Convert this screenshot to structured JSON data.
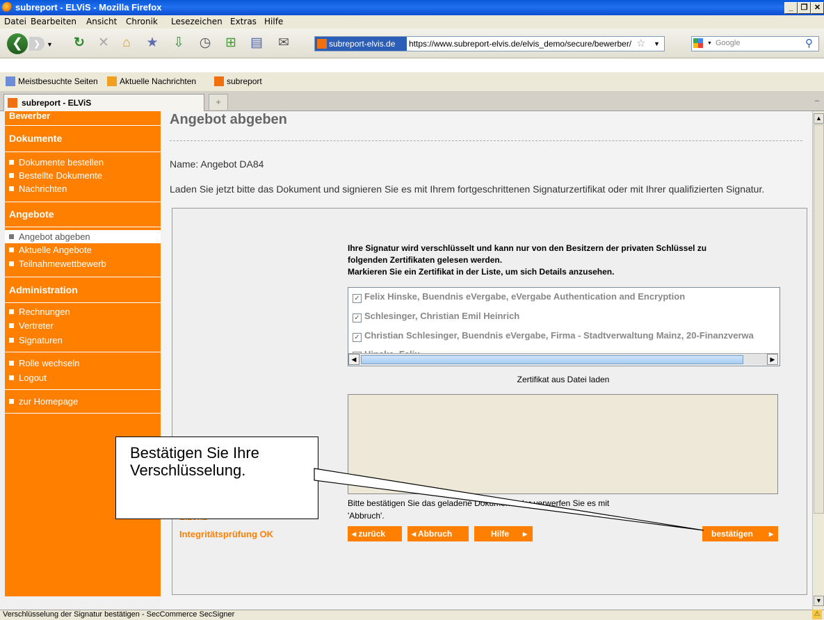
{
  "window": {
    "title": "subreport - ELViS - Mozilla Firefox"
  },
  "menu": [
    "Datei",
    "Bearbeiten",
    "Ansicht",
    "Chronik",
    "Lesezeichen",
    "Extras",
    "Hilfe"
  ],
  "address": {
    "site_label": "subreport-elvis.de",
    "url": "https://www.subreport-elvis.de/elvis_demo/secure/bewerber/",
    "search_placeholder": "Google"
  },
  "bookmarks": [
    "Meistbesuchte Seiten",
    "Aktuelle Nachrichten",
    "subreport"
  ],
  "tab": {
    "title": "subreport - ELViS",
    "new_tab": "+"
  },
  "sidebar": {
    "top_label": "Bewerber",
    "sections": [
      {
        "title": "Dokumente",
        "items": [
          "Dokumente bestellen",
          "Bestellte Dokumente",
          "Nachrichten"
        ]
      },
      {
        "title": "Angebote",
        "items": [
          "Angebot abgeben",
          "Aktuelle Angebote",
          "Teilnahmewettbewerb"
        ]
      },
      {
        "title": "Administration",
        "items": [
          "Rechnungen",
          "Vertreter",
          "Signaturen"
        ]
      }
    ],
    "extra_items": [
      "Rolle wechseln",
      "Logout"
    ],
    "home_item": "zur Homepage"
  },
  "main": {
    "heading": "Angebot abgeben",
    "name_line": "Name: Angebot DA84",
    "instruction": "Laden Sie jetzt bitte das Dokument und signieren Sie es mit Ihrem fortgeschrittenen Signaturzertifikat oder mit Ihrer qualifizierten Signatur."
  },
  "applet": {
    "info_line1": "Ihre Signatur wird verschlüsselt und kann nur von den Besitzern der privaten Schlüssel zu",
    "info_line2": "folgenden Zertifikaten gelesen werden.",
    "info_line3": "Markieren Sie ein Zertifikat in der Liste, um sich Details anzusehen.",
    "certificates": [
      "Felix Hinske, Buendnis eVergabe, eVergabe Authentication and Encryption",
      "Schlesinger, Christian Emil Heinrich",
      "Christian Schlesinger, Buendnis eVergabe, Firma - Stadtverwaltung Mainz, 20-Finanzverwa",
      "Hinske, Felix"
    ],
    "load_cert": "Zertifikat aus Datei laden",
    "confirm_text_1": "Bitte bestätigen Sie das geladene Dokument oder verwerfen Sie es mit",
    "confirm_text_2": "'Abbruch'.",
    "lizenz": "Lizenz",
    "integrity": "Integritätsprüfung OK",
    "buttons": {
      "back": "zurück",
      "cancel": "Abbruch",
      "help": "Hilfe",
      "confirm": "bestätigen"
    }
  },
  "callout": {
    "line1": "Bestätigen Sie Ihre",
    "line2": "Verschlüsselung."
  },
  "status": "Verschlüsselung der Signatur bestätigen - SecCommerce SecSigner",
  "colors": {
    "accent": "#ff7f00",
    "titlebar": "#0a58d8"
  }
}
